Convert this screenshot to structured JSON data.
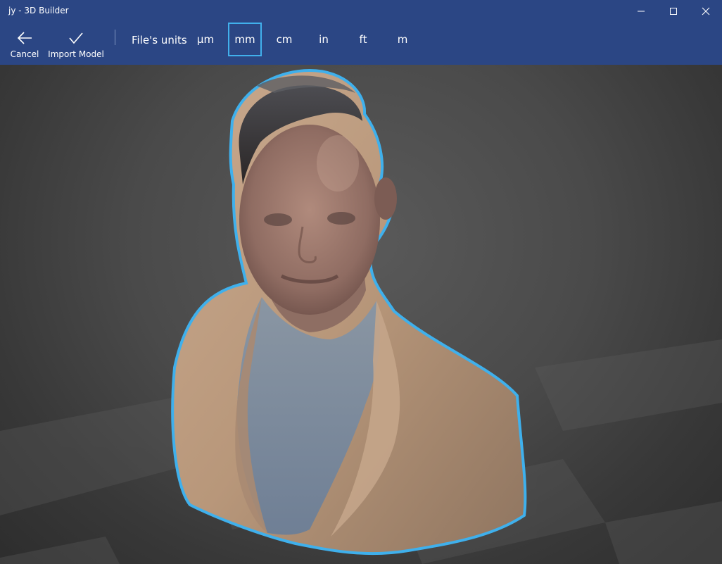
{
  "window": {
    "title": "jy - 3D Builder",
    "controls": [
      "minimize-icon",
      "maximize-icon",
      "close-icon"
    ]
  },
  "toolbar": {
    "cancel_label": "Cancel",
    "cancel_icon": "back-arrow-icon",
    "import_label": "Import Model",
    "import_icon": "checkmark-icon",
    "units_label": "File's units",
    "units": [
      {
        "label": "µm",
        "selected": false
      },
      {
        "label": "mm",
        "selected": true
      },
      {
        "label": "cm",
        "selected": false
      },
      {
        "label": "in",
        "selected": false
      },
      {
        "label": "ft",
        "selected": false
      },
      {
        "label": "m",
        "selected": false
      }
    ]
  },
  "colors": {
    "titlebar": "#2b4684",
    "accent": "#41b0ec",
    "viewport_bg": "#4a4a4a"
  }
}
